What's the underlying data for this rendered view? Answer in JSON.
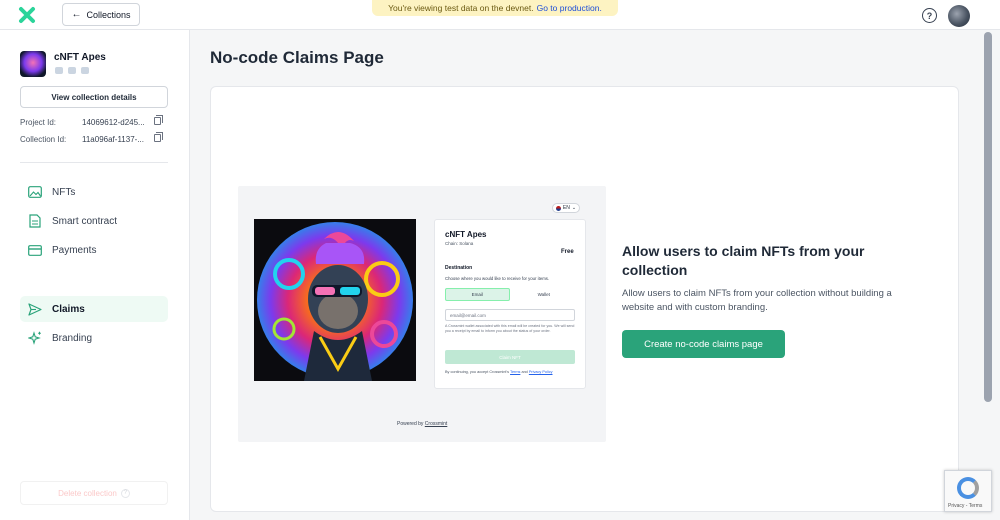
{
  "topbar": {
    "back_label": "Collections",
    "banner_text": "You're viewing test data on the devnet.",
    "banner_link": "Go to production.",
    "help_symbol": "?"
  },
  "sidebar": {
    "collection_name": "cNFT Apes",
    "view_details_label": "View collection details",
    "project_id_label": "Project Id:",
    "project_id_value": "14069612-d245...",
    "collection_id_label": "Collection Id:",
    "collection_id_value": "11a096af-1137-...",
    "nav": [
      {
        "label": "NFTs",
        "icon": "image-icon"
      },
      {
        "label": "Smart contract",
        "icon": "document-icon"
      },
      {
        "label": "Payments",
        "icon": "credit-card-icon"
      },
      {
        "label": "Claims",
        "icon": "send-icon",
        "active": true
      },
      {
        "label": "Branding",
        "icon": "sparkles-icon"
      }
    ],
    "delete_label": "Delete collection"
  },
  "main": {
    "title": "No-code Claims Page",
    "preview": {
      "lang": "EN",
      "name": "cNFT Apes",
      "chain": "Chain: Solana",
      "price": "Free",
      "destination": "Destination",
      "choose": "Choose where you would like to receive for your items.",
      "tab_email": "Email",
      "tab_wallet": "Wallet",
      "email_placeholder": "email@email.com",
      "note": "A Crossmint wallet associated with this email will be created for you. We will send you a receipt by email to inform you about the status of your order.",
      "claim": "Claim NFT",
      "terms_prefix": "By continuing, you accept Crossmint's",
      "terms": "Terms",
      "and": "and",
      "privacy": "Privacy Policy",
      "powered_prefix": "Powered by",
      "powered_link": "Crossmint"
    },
    "cta_heading": "Allow users to claim NFTs from your collection",
    "cta_description": "Allow users to claim NFTs from your collection without building a website and with custom branding.",
    "cta_button": "Create no-code claims page"
  },
  "recaptcha": {
    "text": "Privacy - Terms"
  },
  "colors": {
    "accent": "#2aa37a",
    "banner": "#fdf3c2",
    "active_nav": "#eefaf4"
  }
}
